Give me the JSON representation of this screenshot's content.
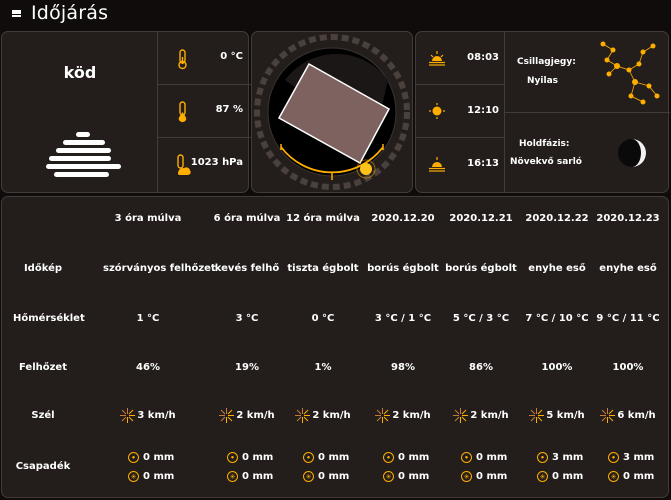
{
  "page": {
    "title": "Időjárás"
  },
  "current": {
    "condition": "köd",
    "temperature": "0 °C",
    "humidity": "87 %",
    "pressure": "1023 hPa"
  },
  "sun": {
    "times": [
      "08:03",
      "12:10",
      "16:13"
    ],
    "zodiac_label": "Csillagjegy:",
    "zodiac_value": "Nyilas",
    "moon_label": "Holdfázis:",
    "moon_value": "Növekvő sarló"
  },
  "colors": {
    "accent": "#ffae00",
    "card": "#231e1c",
    "border": "#423c39",
    "background": "#0f0c0b"
  },
  "forecast": {
    "row_labels": [
      "Időkép",
      "Hőmérséklet",
      "Felhőzet",
      "Szél",
      "Csapadék"
    ],
    "columns": [
      {
        "header": "3 óra múlva",
        "sky": "szórványos felhőzet",
        "temp": "1 °C",
        "clouds": "46%",
        "wind": "3 km/h",
        "rain": "0 mm",
        "snow": "0 mm"
      },
      {
        "header": "6 óra múlva",
        "sky": "kevés felhő",
        "temp": "3 °C",
        "clouds": "19%",
        "wind": "2 km/h",
        "rain": "0 mm",
        "snow": "0 mm"
      },
      {
        "header": "12 óra múlva",
        "sky": "tiszta égbolt",
        "temp": "0 °C",
        "clouds": "1%",
        "wind": "2 km/h",
        "rain": "0 mm",
        "snow": "0 mm"
      },
      {
        "header": "2020.12.20",
        "sky": "borús égbolt",
        "temp": "3 °C / 1 °C",
        "clouds": "98%",
        "wind": "2 km/h",
        "rain": "0 mm",
        "snow": "0 mm"
      },
      {
        "header": "2020.12.21",
        "sky": "borús égbolt",
        "temp": "5 °C / 3 °C",
        "clouds": "86%",
        "wind": "2 km/h",
        "rain": "0 mm",
        "snow": "0 mm"
      },
      {
        "header": "2020.12.22",
        "sky": "enyhe eső",
        "temp": "7 °C / 10 °C",
        "clouds": "100%",
        "wind": "5 km/h",
        "rain": "3 mm",
        "snow": "0 mm"
      },
      {
        "header": "2020.12.23",
        "sky": "enyhe eső",
        "temp": "9 °C / 11 °C",
        "clouds": "100%",
        "wind": "6 km/h",
        "rain": "3 mm",
        "snow": "0 mm"
      }
    ]
  }
}
